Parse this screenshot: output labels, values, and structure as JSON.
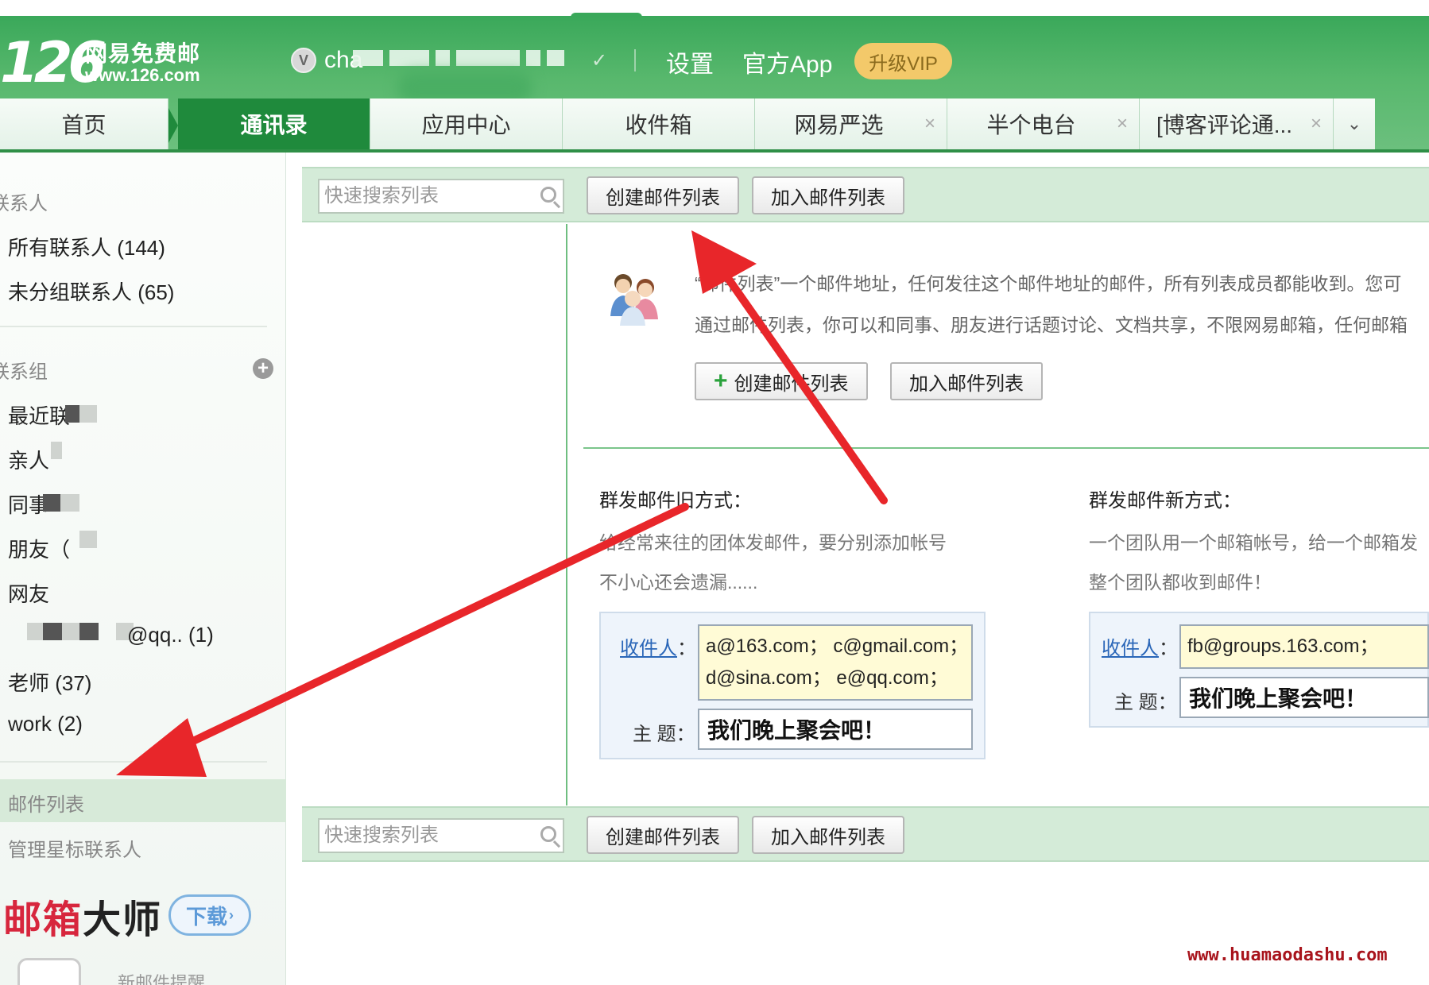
{
  "header": {
    "logo_number": "126",
    "logo_cn": "网易免费邮",
    "logo_url": "www.126.com",
    "vip_badge": "V",
    "username": "cha",
    "settings": "设置",
    "app": "官方App",
    "vip": "升级VIP"
  },
  "tabs": [
    {
      "label": "首页"
    },
    {
      "label": "通讯录"
    },
    {
      "label": "应用中心"
    },
    {
      "label": "收件箱"
    },
    {
      "label": "网易严选",
      "close": "×"
    },
    {
      "label": "半个电台",
      "close": "×"
    },
    {
      "label": "[博客评论通...",
      "close": "×"
    }
  ],
  "tabs_more": "⌄",
  "sidebar": {
    "contacts_section": "联系人",
    "all_contacts": "所有联系人 (144)",
    "ungrouped": "未分组联系人 (65)",
    "groups_section": "联系组",
    "groups": [
      {
        "label": "最近联"
      },
      {
        "label": "亲人"
      },
      {
        "label": "同事"
      },
      {
        "label": "朋友（"
      },
      {
        "label": "网友"
      },
      {
        "label": "@qq.. (1)"
      },
      {
        "label": "老师 (37)"
      },
      {
        "label": "work (2)"
      }
    ],
    "mail_list": "邮件列表",
    "starred": "管理星标联系人",
    "promo_red": "邮箱",
    "promo_dark": "大师",
    "download": "下载",
    "new_mail": "新邮件提醒"
  },
  "toolbar": {
    "search_placeholder": "快速搜索列表",
    "create": "创建邮件列表",
    "join": "加入邮件列表"
  },
  "intro": {
    "line1": "“邮件列表”一个邮件地址，任何发往这个邮件地址的邮件，所有列表成员都能收到。您可",
    "line2": "通过邮件列表，你可以和同事、朋友进行话题讨论、文档共享，不限网易邮箱，任何邮箱",
    "create": "创建邮件列表",
    "join": "加入邮件列表"
  },
  "old_way": {
    "title": "群发邮件旧方式：",
    "desc1": "给经常来往的团体发邮件，要分别添加帐号",
    "desc2": "不小心还会遗漏......",
    "to_label": "收件人",
    "colon": "：",
    "recipients1": "a@163.com；  c@gmail.com；",
    "recipients2": "d@sina.com；  e@qq.com；",
    "subject_label": "主 题：",
    "subject": "我们晚上聚会吧！"
  },
  "new_way": {
    "title": "群发邮件新方式：",
    "desc1": "一个团队用一个邮箱帐号，给一个邮箱发",
    "desc2": "整个团队都收到邮件！",
    "to_label": "收件人",
    "colon": "：",
    "recipients": "fb@groups.163.com；",
    "subject_label": "主 题：",
    "subject": "我们晚上聚会吧！"
  },
  "watermark": "www.huamaodashu.com",
  "colors": {
    "header_green": "#3aa85a",
    "active_tab": "#1f8a3c",
    "toolbar_bg": "#d4ebd8",
    "arrow_red": "#e8262a",
    "link_blue": "#2a66b8"
  }
}
